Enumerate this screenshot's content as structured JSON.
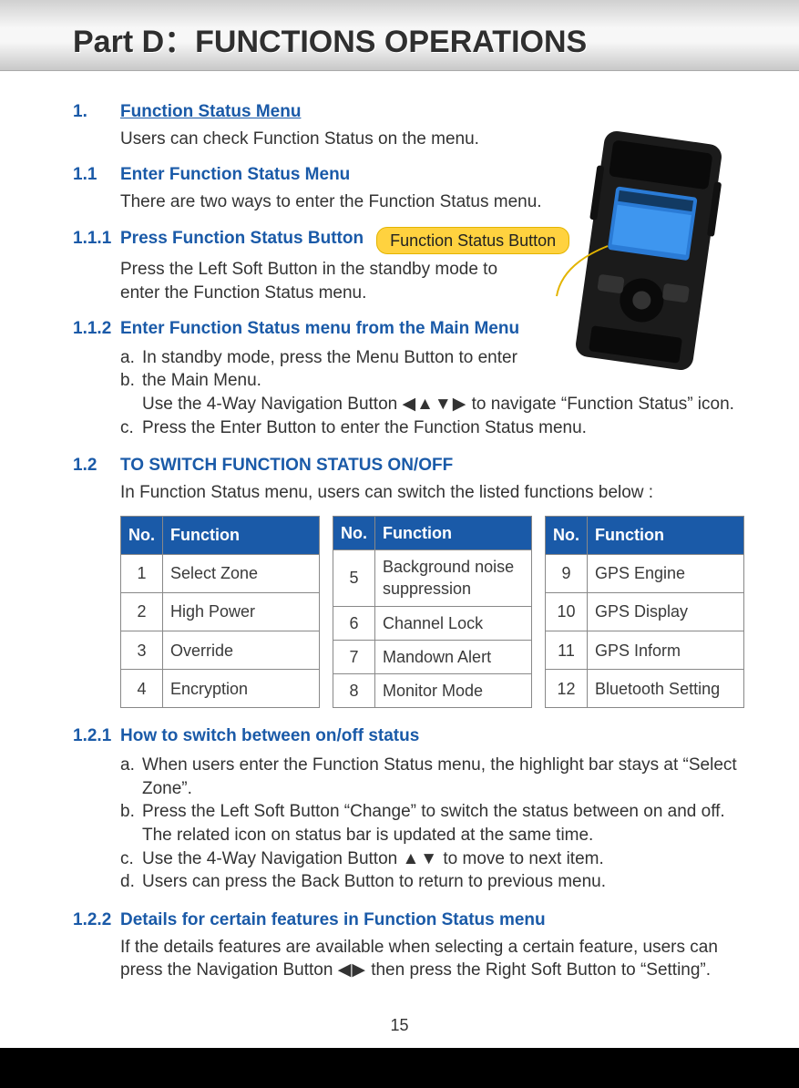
{
  "header": {
    "title": "Part D：FUNCTIONS OPERATIONS"
  },
  "s1": {
    "num": "1.",
    "title": "Function Status Menu",
    "text": "Users can check Function Status on the menu."
  },
  "s1_1": {
    "num": "1.1",
    "title": "Enter Function Status Menu",
    "text": "There are two ways to enter the Function Status menu."
  },
  "s1_1_1": {
    "num": "1.1.1",
    "title": "Press Function Status Button",
    "callout": "Function Status Button",
    "text": "Press the Left Soft Button in the standby mode to enter the Function Status menu."
  },
  "s1_1_2": {
    "num": "1.1.2",
    "title": "Enter Function Status menu from the Main Menu",
    "a_lab": "a.",
    "a": "In standby mode, press the Menu Button to enter",
    "b_lab": "b.",
    "b": "the Main Menu.",
    "b2_pre": "Use the 4-Way Navigation Button ",
    "b2_sym": "◀▲▼▶",
    "b2_post": " to navigate “Function Status” icon.",
    "c_lab": "c.",
    "c": "Press the Enter Button to enter the Function Status menu."
  },
  "s1_2": {
    "num": "1.2",
    "title": "TO SWITCH FUNCTION STATUS ON/OFF",
    "text": "In Function Status menu, users can switch the listed functions below :"
  },
  "table_headers": {
    "no": "No.",
    "fn": "Function"
  },
  "t1": [
    {
      "no": "1",
      "fn": "Select Zone"
    },
    {
      "no": "2",
      "fn": "High Power"
    },
    {
      "no": "3",
      "fn": "Override"
    },
    {
      "no": "4",
      "fn": "Encryption"
    }
  ],
  "t2": [
    {
      "no": "5",
      "fn": "Background noise suppression"
    },
    {
      "no": "6",
      "fn": "Channel Lock"
    },
    {
      "no": "7",
      "fn": "Mandown Alert"
    },
    {
      "no": "8",
      "fn": "Monitor Mode"
    }
  ],
  "t3": [
    {
      "no": "9",
      "fn": "GPS Engine"
    },
    {
      "no": "10",
      "fn": "GPS Display"
    },
    {
      "no": "11",
      "fn": "GPS Inform"
    },
    {
      "no": "12",
      "fn": "Bluetooth Setting"
    }
  ],
  "s1_2_1": {
    "num": "1.2.1",
    "title": "How to switch between on/off status",
    "a_lab": "a.",
    "a": "When users enter the Function Status menu, the highlight bar stays at “Select Zone”.",
    "b_lab": "b.",
    "b": "Press the Left Soft Button “Change” to switch the status between on and off. The related icon on status bar is updated at the same time.",
    "c_lab": "c.",
    "c_pre": "Use the 4-Way Navigation Button ",
    "c_sym": "▲▼",
    "c_post": " to move to next item.",
    "d_lab": "d.",
    "d": "Users can press the Back Button to return to previous menu."
  },
  "s1_2_2": {
    "num": "1.2.2",
    "title": "Details for certain features in Function Status menu",
    "text_pre": "If the details features are available when selecting a certain feature, users can press the Navigation Button ",
    "text_sym": "◀▶",
    "text_post": " then press the Right Soft Button to “Setting”."
  },
  "page_number": "15"
}
